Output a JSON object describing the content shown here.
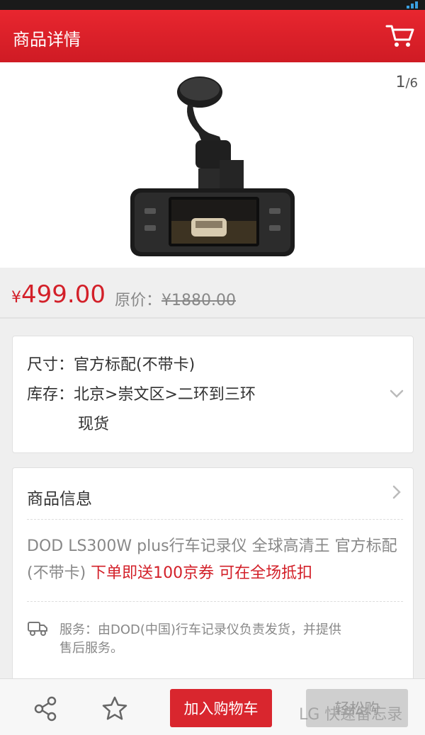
{
  "colors": {
    "brand_red": "#d9262e",
    "price_red": "#d32029",
    "header_red": "#e8262f"
  },
  "header": {
    "title": "商品详情",
    "cart_icon": "shopping-cart-icon"
  },
  "gallery": {
    "current": "1",
    "total": "/6"
  },
  "price": {
    "currency": "¥",
    "value": "499.00",
    "original_label": "原价：",
    "original_value": "¥1880.00"
  },
  "specs": {
    "size_label": "尺寸：",
    "size_value": "官方标配(不带卡)",
    "stock_label": "库存：",
    "stock_value": "北京>崇文区>二环到三环",
    "stock_status": "现货"
  },
  "info": {
    "title": "商品信息",
    "description": "DOD LS300W plus行车记录仪 全球高清王 官方标配 (不带卡)",
    "promo": "下单即送100京券 可在全场抵扣",
    "service_line1": "服务：由DOD(中国)行车记录仪负责发货，并提供",
    "service_line2": "售后服务。"
  },
  "bottom": {
    "add_to_cart": "加入购物车",
    "easy_buy": "轻松购",
    "share_icon": "share-icon",
    "favorite_icon": "star-icon"
  },
  "watermark": "LG 快速备忘录"
}
